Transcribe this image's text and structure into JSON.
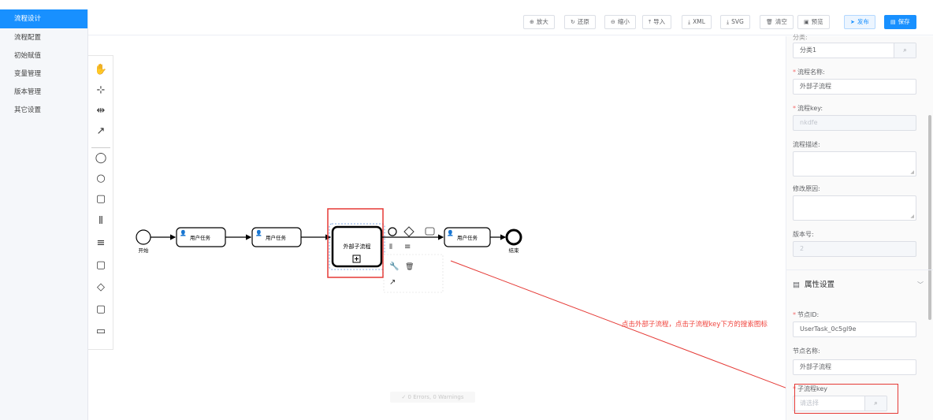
{
  "sidebar": {
    "items": [
      {
        "label": "流程设计",
        "active": true
      },
      {
        "label": "流程配置",
        "active": false
      },
      {
        "label": "初始赋值",
        "active": false
      },
      {
        "label": "变量管理",
        "active": false
      },
      {
        "label": "版本管理",
        "active": false
      },
      {
        "label": "其它设置",
        "active": false
      }
    ]
  },
  "toolbar": {
    "zoom_in": "放大",
    "restore": "还原",
    "zoom_out": "缩小",
    "import": "导入",
    "xml": "XML",
    "svg": "SVG",
    "clear": "清空",
    "preview": "预览",
    "publish": "发布",
    "save": "保存"
  },
  "diagram": {
    "start_label": "开始",
    "end_label": "结束",
    "task1": "用户任务",
    "task2": "用户任务",
    "subprocess": "外部子流程",
    "task3": "用户任务"
  },
  "status": "✓ 0 Errors, 0 Warnings",
  "annotation": "点击外部子流程，点击子流程key下方的搜索图标",
  "panel": {
    "category_label": "分类:",
    "category_value": "分类1",
    "process_name_label": "流程名称:",
    "process_name_value": "外部子流程",
    "process_key_label": "流程key:",
    "process_key_value": "nkdfe",
    "description_label": "流程描述:",
    "reason_label": "修改原因:",
    "version_label": "版本号:",
    "version_value": "2",
    "section_title": "属性设置",
    "node_id_label": "节点ID:",
    "node_id_value": "UserTask_0c5gl9e",
    "node_name_label": "节点名称:",
    "node_name_value": "外部子流程",
    "sub_key_label": "子流程key",
    "sub_key_placeholder": "请选择"
  },
  "colors": {
    "primary": "#1890ff",
    "annotation": "#e53935"
  }
}
